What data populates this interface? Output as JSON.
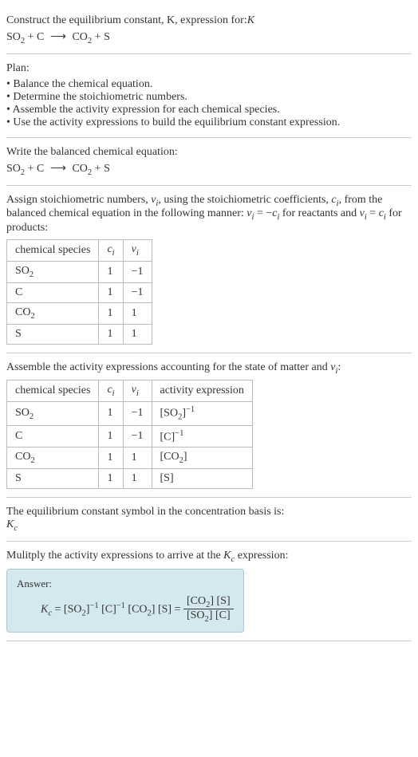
{
  "title": {
    "line1": "Construct the equilibrium constant, K, expression for:",
    "equation_so2": "SO",
    "equation_so2_sub": "2",
    "plus1": " + C ",
    "arrow": "⟶",
    "equation_co2": " CO",
    "equation_co2_sub": "2",
    "plus2": " + S"
  },
  "plan": {
    "heading": "Plan:",
    "item1": "• Balance the chemical equation.",
    "item2": "• Determine the stoichiometric numbers.",
    "item3": "• Assemble the activity expression for each chemical species.",
    "item4": "• Use the activity expressions to build the equilibrium constant expression."
  },
  "balanced": {
    "heading": "Write the balanced chemical equation:",
    "so2": "SO",
    "so2_sub": "2",
    "plus1": " + C ",
    "arrow": "⟶",
    "co2": " CO",
    "co2_sub": "2",
    "plus2": " + S"
  },
  "stoich": {
    "text1": "Assign stoichiometric numbers, ",
    "nu_i": "ν",
    "nu_i_sub": "i",
    "text2": ", using the stoichiometric coefficients, ",
    "c_i": "c",
    "c_i_sub": "i",
    "text3": ", from the balanced chemical equation in the following manner: ",
    "eq1_nu": "ν",
    "eq1_nu_sub": "i",
    "eq1_eq": " = −",
    "eq1_c": "c",
    "eq1_c_sub": "i",
    "text4": " for reactants and ",
    "eq2_nu": "ν",
    "eq2_nu_sub": "i",
    "eq2_eq": " = ",
    "eq2_c": "c",
    "eq2_c_sub": "i",
    "text5": " for products:",
    "table": {
      "h1": "chemical species",
      "h2_c": "c",
      "h2_sub": "i",
      "h3_nu": "ν",
      "h3_sub": "i",
      "r1_sp": "SO",
      "r1_sp_sub": "2",
      "r1_c": "1",
      "r1_nu": "−1",
      "r2_sp": "C",
      "r2_c": "1",
      "r2_nu": "−1",
      "r3_sp": "CO",
      "r3_sp_sub": "2",
      "r3_c": "1",
      "r3_nu": "1",
      "r4_sp": "S",
      "r4_c": "1",
      "r4_nu": "1"
    }
  },
  "activity": {
    "heading": "Assemble the activity expressions accounting for the state of matter and ",
    "nu": "ν",
    "nu_sub": "i",
    "colon": ":",
    "table": {
      "h1": "chemical species",
      "h2_c": "c",
      "h2_sub": "i",
      "h3_nu": "ν",
      "h3_sub": "i",
      "h4": "activity expression",
      "r1_sp": "SO",
      "r1_sp_sub": "2",
      "r1_c": "1",
      "r1_nu": "−1",
      "r1_a": "[SO",
      "r1_a_sub": "2",
      "r1_a_close": "]",
      "r1_a_sup": "−1",
      "r2_sp": "C",
      "r2_c": "1",
      "r2_nu": "−1",
      "r2_a": "[C]",
      "r2_a_sup": "−1",
      "r3_sp": "CO",
      "r3_sp_sub": "2",
      "r3_c": "1",
      "r3_nu": "1",
      "r3_a": "[CO",
      "r3_a_sub": "2",
      "r3_a_close": "]",
      "r4_sp": "S",
      "r4_c": "1",
      "r4_nu": "1",
      "r4_a": "[S]"
    }
  },
  "symbol": {
    "text": "The equilibrium constant symbol in the concentration basis is:",
    "kc": "K",
    "kc_sub": "c"
  },
  "multiply": {
    "text1": "Mulitply the activity expressions to arrive at the ",
    "kc": "K",
    "kc_sub": "c",
    "text2": " expression:"
  },
  "answer": {
    "label": "Answer:",
    "kc": "K",
    "kc_sub": "c",
    "eq": " = [SO",
    "so2_sub": "2",
    "so2_close": "]",
    "so2_sup": "−1",
    "c_part": " [C]",
    "c_sup": "−1",
    "co2_part": " [CO",
    "co2_sub": "2",
    "co2_close": "] [S] = ",
    "num_co2": "[CO",
    "num_co2_sub": "2",
    "num_co2_close": "] [S]",
    "den_so2": "[SO",
    "den_so2_sub": "2",
    "den_so2_close": "] [C]"
  }
}
